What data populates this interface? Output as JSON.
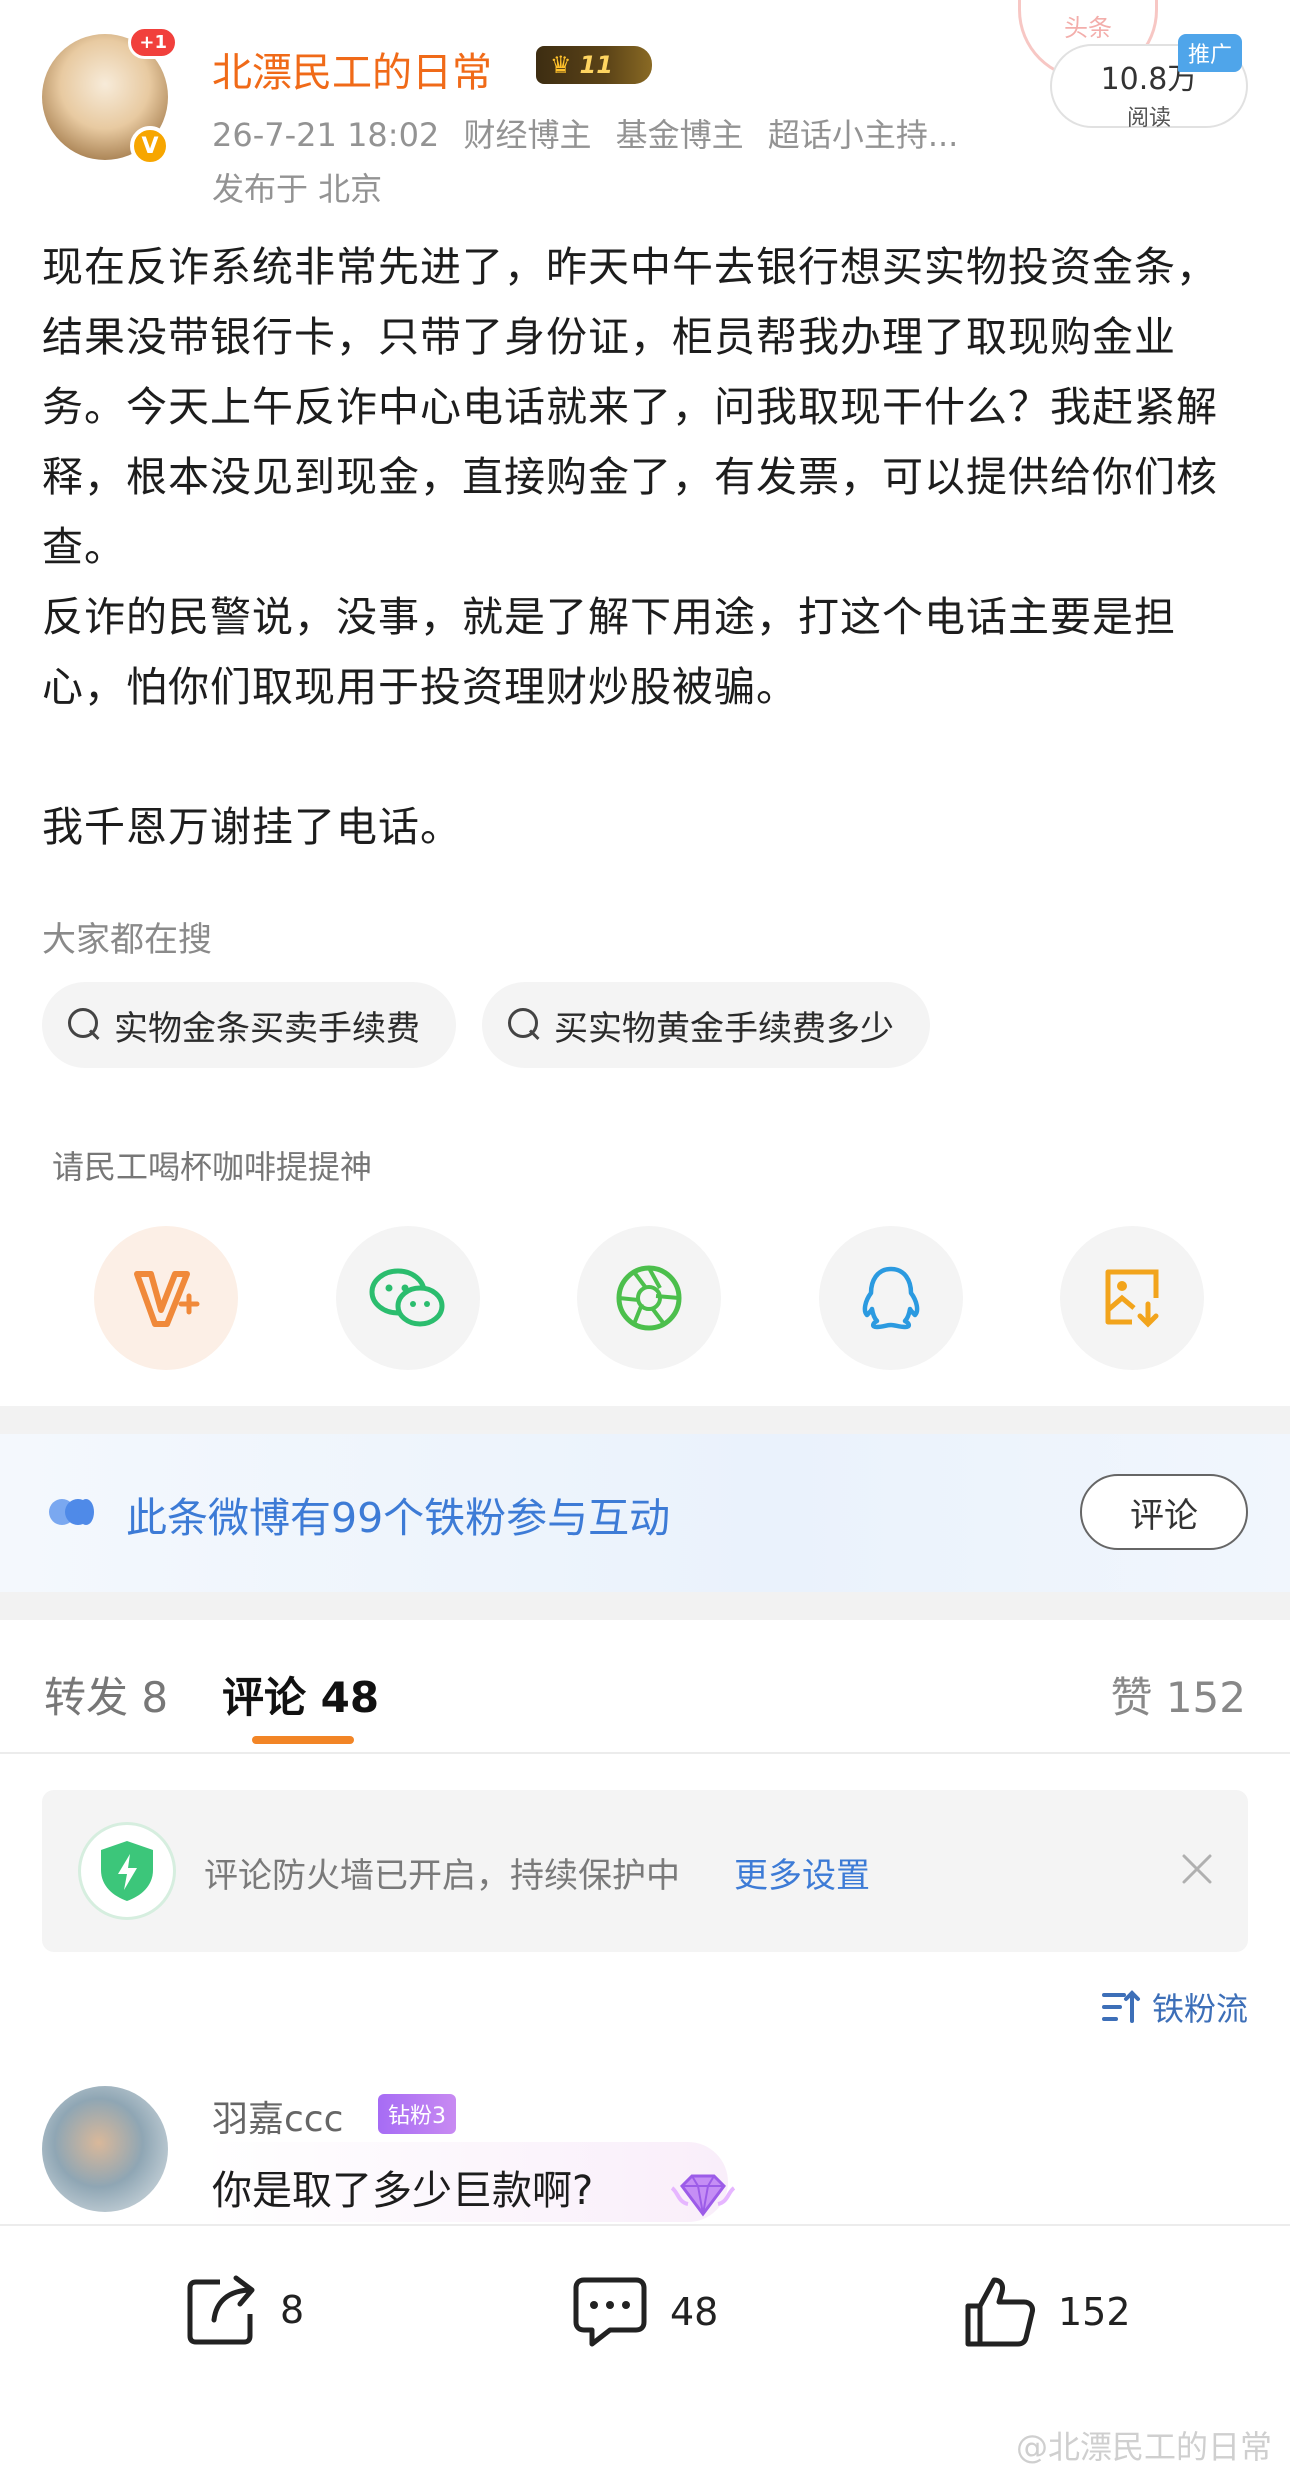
{
  "header": {
    "username": "北漂民工的日常",
    "level": "11",
    "timestamp": "26-7-21 18:02",
    "tags": [
      "财经博主",
      "基金博主",
      "超话小主持..."
    ],
    "location": "发布于 北京",
    "avatar_badge": "+1",
    "stamp_text": "头条",
    "reads_count": "10.8万",
    "reads_label": "阅读",
    "promo_tag": "推广"
  },
  "post": {
    "text": "现在反诈系统非常先进了，昨天中午去银行想买实物投资金条，结果没带银行卡，只带了身份证，柜员帮我办理了取现购金业务。今天上午反诈中心电话就来了，问我取现干什么？我赶紧解释，根本没见到现金，直接购金了，有发票，可以提供给你们核查。\n反诈的民警说，没事，就是了解下用途，打这个电话主要是担心，怕你们取现用于投资理财炒股被骗。\n\n我千恩万谢挂了电话。"
  },
  "search": {
    "title": "大家都在搜",
    "chips": [
      "实物金条买卖手续费",
      "买实物黄金手续费多少"
    ]
  },
  "share": {
    "coffee_label": "请民工喝杯咖啡提提神",
    "icons": [
      "vip-charge-icon",
      "wechat-icon",
      "moments-icon",
      "qq-icon",
      "save-image-icon"
    ]
  },
  "fans_banner": {
    "text": "此条微博有99个铁粉参与互动",
    "button": "评论"
  },
  "tabs": {
    "repost": "转发 8",
    "comment": "评论 48",
    "like": "赞 152"
  },
  "firewall": {
    "text": "评论防火墙已开启，持续保护中",
    "link": "更多设置"
  },
  "sort_label": "铁粉流",
  "comment": {
    "name": "羽嘉ccc",
    "badge": "钻粉3",
    "text": "你是取了多少巨款啊?"
  },
  "bottom_bar": {
    "repost_count": "8",
    "comment_count": "48",
    "like_count": "152"
  },
  "watermark": "@北漂民工的日常",
  "colors": {
    "username": "#f06a18",
    "link_blue": "#3d7bd6",
    "tab_underline": "#f28526",
    "vip_badge": "#a66cf4"
  }
}
